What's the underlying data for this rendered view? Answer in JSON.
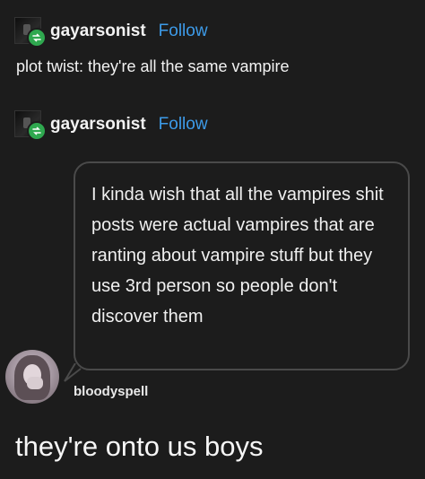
{
  "posts": [
    {
      "username": "gayarsonist",
      "follow_label": "Follow",
      "text": "plot twist: they're all the same vampire"
    },
    {
      "username": "gayarsonist",
      "follow_label": "Follow"
    }
  ],
  "quote": {
    "text": "I kinda wish that all the vampires shit posts were actual vampires that are ranting about vampire stuff but they use 3rd person so people don't discover them",
    "author": "bloodyspell"
  },
  "caption": "they're onto us boys",
  "colors": {
    "background": "#1c1c1c",
    "follow": "#3d9be9",
    "reblog_badge": "#2fa84f",
    "bubble_border": "#4a4a4a"
  },
  "icons": {
    "reblog": "reblog-icon"
  }
}
